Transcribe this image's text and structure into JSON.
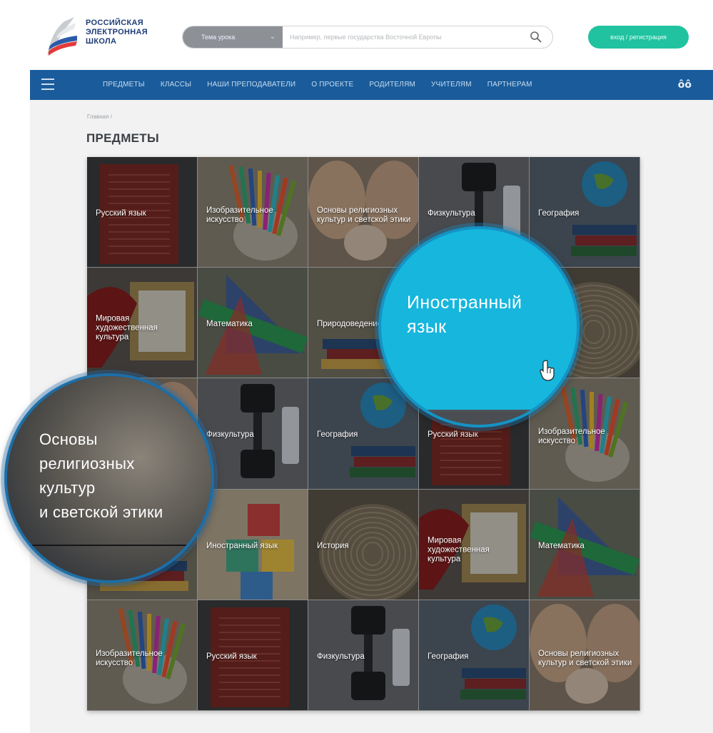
{
  "logo": {
    "line1": "РОССИЙСКАЯ",
    "line2": "ЭЛЕКТРОННАЯ",
    "line3": "ШКОЛА"
  },
  "search": {
    "select_label": "Тема урока",
    "placeholder": "Например, первые государства Восточной Европы"
  },
  "header": {
    "login_label": "вход / регистрация"
  },
  "nav": {
    "items": [
      "ПРЕДМЕТЫ",
      "КЛАССЫ",
      "НАШИ ПРЕПОДАВАТЕЛИ",
      "О ПРОЕКТЕ",
      "РОДИТЕЛЯМ",
      "УЧИТЕЛЯМ",
      "ПАРТНЕРАМ"
    ],
    "glasses_symbol": "ôô"
  },
  "breadcrumb": {
    "home": "Главная /"
  },
  "page": {
    "title": "ПРЕДМЕТЫ"
  },
  "tiles": [
    {
      "label": "Русский язык",
      "icon": "book-icon",
      "color": "#7d2b25"
    },
    {
      "label": "Изобразительное искусство",
      "icon": "pencils-icon",
      "color": "#6a6357"
    },
    {
      "label": "Основы религиозных культур и светской этики",
      "icon": "hands-icon",
      "color": "#7b6b5d"
    },
    {
      "label": "Физкультура",
      "icon": "dumbbell-icon",
      "color": "#4a4d52"
    },
    {
      "label": "География",
      "icon": "globe-icon",
      "color": "#3e5260"
    },
    {
      "label": "Мировая художественная культура",
      "icon": "frame-icon",
      "color": "#6a2a2a"
    },
    {
      "label": "Математика",
      "icon": "ruler-icon",
      "color": "#4f5a44"
    },
    {
      "label": "Природоведение",
      "icon": "books-icon",
      "color": "#5c584a"
    },
    {
      "label": "Иностранный язык",
      "icon": "blocks-icon",
      "color": "#16b6dd"
    },
    {
      "label": "",
      "icon": "rope-icon",
      "color": "#655c50"
    },
    {
      "label": "",
      "icon": "hands-icon",
      "color": "#5a544c"
    },
    {
      "label": "Физкультура",
      "icon": "dumbbell-icon",
      "color": "#4a4d52"
    },
    {
      "label": "География",
      "icon": "globe-icon",
      "color": "#3e5260"
    },
    {
      "label": "Русский язык",
      "icon": "book-icon",
      "color": "#7d2b25"
    },
    {
      "label": "Изобразительное искусство",
      "icon": "pencils-icon",
      "color": "#6a6357"
    },
    {
      "label": "",
      "icon": "books-icon",
      "color": "#5c584a"
    },
    {
      "label": "Иностранный язык",
      "icon": "blocks-icon",
      "color": "#6a5f50"
    },
    {
      "label": "История",
      "icon": "rope-icon",
      "color": "#655c50"
    },
    {
      "label": "Мировая художественная культура",
      "icon": "frame-icon",
      "color": "#6a2a2a"
    },
    {
      "label": "Математика",
      "icon": "ruler-icon",
      "color": "#4f5a44"
    },
    {
      "label": "Изобразительное искусство",
      "icon": "pencils-icon",
      "color": "#6a6357"
    },
    {
      "label": "Русский язык",
      "icon": "book-icon",
      "color": "#7d2b25"
    },
    {
      "label": "Физкультура",
      "icon": "dumbbell-icon",
      "color": "#4a4d52"
    },
    {
      "label": "География",
      "icon": "globe-icon",
      "color": "#3e5260"
    },
    {
      "label": "Основы религиозных культур и светской этики",
      "icon": "hands-icon",
      "color": "#7b6b5d"
    }
  ],
  "zoom": {
    "blue_text": "Иностранный язык",
    "dark_line1": "Основы",
    "dark_line2": "религиозных",
    "dark_line3": "культур",
    "dark_line4": "и светской этики"
  },
  "colors": {
    "brand_blue": "#1a5c9b",
    "accent_green": "#21c2a0",
    "bubble_cyan": "#16b6dd"
  }
}
